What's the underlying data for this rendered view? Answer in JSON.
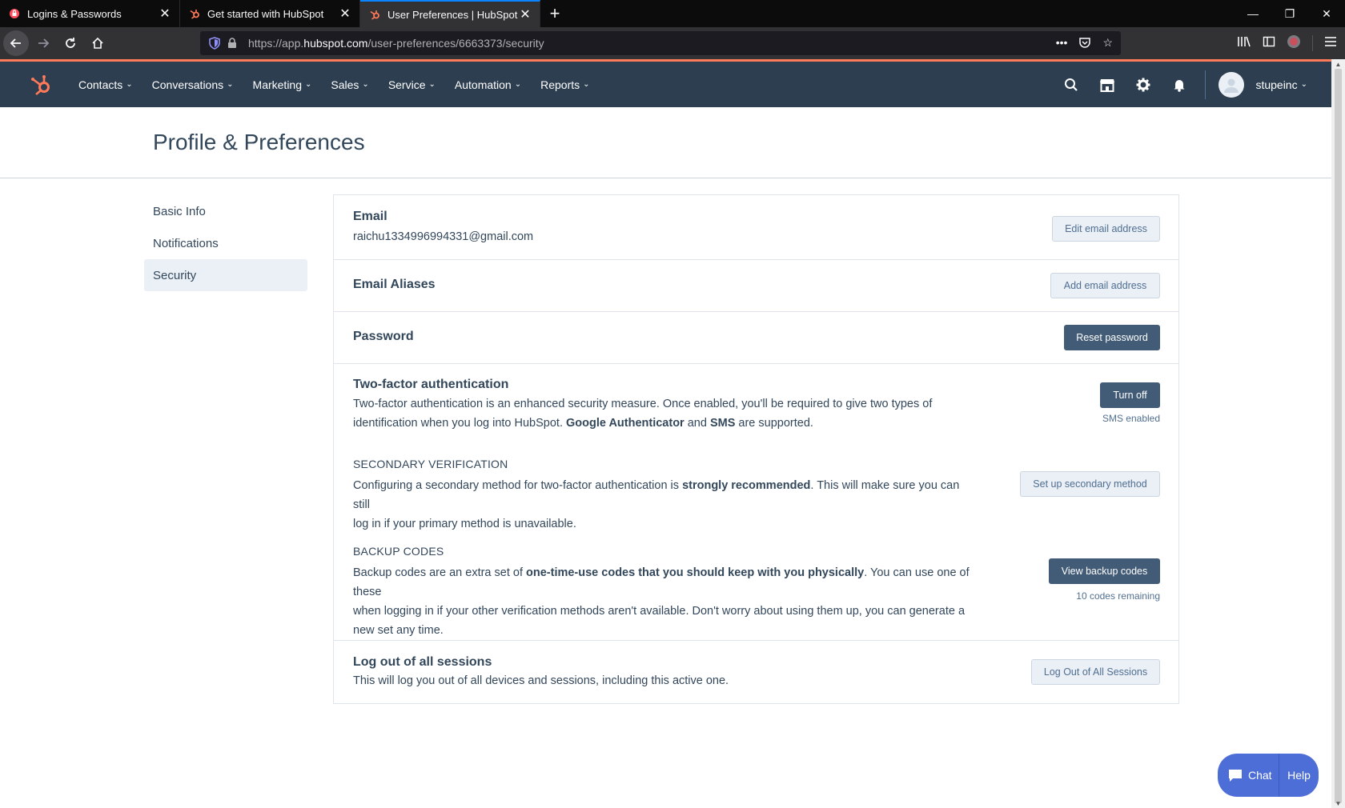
{
  "browser": {
    "tabs": [
      {
        "title": "Logins & Passwords",
        "active": false,
        "favicon": "firefox-lockwise-icon"
      },
      {
        "title": "Get started with HubSpot",
        "active": false,
        "favicon": "hubspot-icon"
      },
      {
        "title": "User Preferences | HubSpot",
        "active": true,
        "favicon": "hubspot-icon"
      }
    ],
    "url_prefix": "https://app.",
    "url_domain": "hubspot.com",
    "url_path": "/user-preferences/6663373/security"
  },
  "hubspot_nav": {
    "menu": [
      "Contacts",
      "Conversations",
      "Marketing",
      "Sales",
      "Service",
      "Automation",
      "Reports"
    ],
    "account_name": "stupeinc"
  },
  "page": {
    "title": "Profile & Preferences"
  },
  "sidebar": {
    "items": [
      {
        "label": "Basic Info"
      },
      {
        "label": "Notifications"
      },
      {
        "label": "Security"
      }
    ]
  },
  "security": {
    "email": {
      "title": "Email",
      "value": "raichu1334996994331@gmail.com",
      "button": "Edit email address"
    },
    "aliases": {
      "title": "Email Aliases",
      "button": "Add email address"
    },
    "password": {
      "title": "Password",
      "button": "Reset password"
    },
    "two_factor": {
      "title": "Two-factor authentication",
      "text_1": "Two-factor authentication is an enhanced security measure. Once enabled, you'll be required to give two types of",
      "text_2a": "identification when you log into HubSpot. ",
      "text_2b": "Google Authenticator",
      "text_2c": " and ",
      "text_2d": "SMS",
      "text_2e": " are supported.",
      "button": "Turn off",
      "status": "SMS enabled",
      "secondary": {
        "title": "SECONDARY VERIFICATION",
        "text_1a": "Configuring a secondary method for two-factor authentication is ",
        "text_1b": "strongly recommended",
        "text_1c": ". This will make sure you can still",
        "text_2": "log in if your primary method is unavailable.",
        "button": "Set up secondary method"
      },
      "backup": {
        "title": "BACKUP CODES",
        "text_1a": "Backup codes are an extra set of ",
        "text_1b": "one-time-use codes that you should keep with you physically",
        "text_1c": ". You can use one of these",
        "text_2": "when logging in if your other verification methods aren't available. Don't worry about using them up, you can generate a",
        "text_3": "new set any time.",
        "button": "View backup codes",
        "status": "10 codes remaining"
      }
    },
    "logout": {
      "title": "Log out of all sessions",
      "text": "This will log you out of all devices and sessions, including this active one.",
      "button": "Log Out of All Sessions"
    }
  },
  "chat_widget": {
    "chat_label": "Chat",
    "help_label": "Help"
  },
  "colors": {
    "hubspot_nav": "#2d3e50",
    "accent": "#ff7a59",
    "primary_button": "#425b76",
    "chat_widget": "#4d6ed6"
  }
}
